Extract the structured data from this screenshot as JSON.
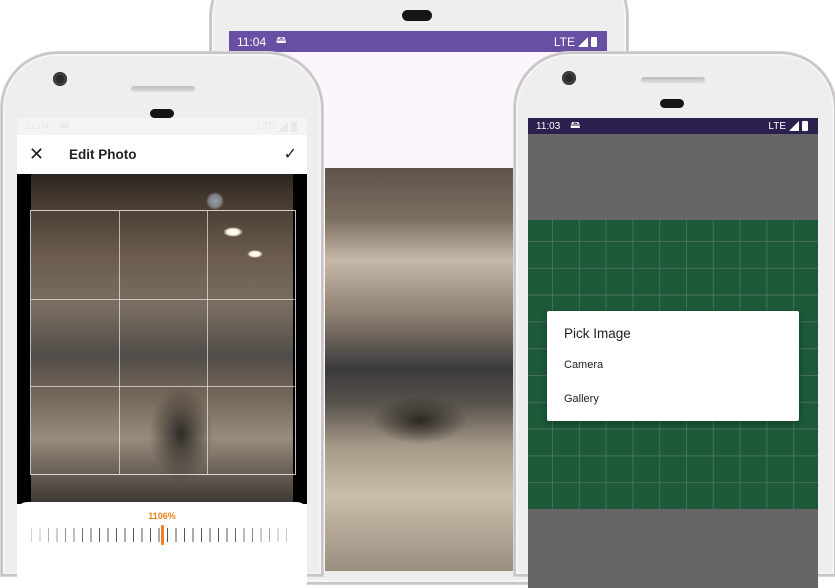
{
  "colors": {
    "accent_orange": "#f07f1d",
    "purple_status": "#6750a4",
    "dark_status": "#2a1f4d",
    "grid_green": "#1c5a3a",
    "scrim_gray": "#666567",
    "pale_pink": "#fcf5fd"
  },
  "left_phone": {
    "status": {
      "time": "11:04",
      "sim_icon": "sim-icon",
      "network": "LTE"
    },
    "toolbar": {
      "close_icon": "close-icon",
      "title": "Edit Photo",
      "confirm_icon": "check-icon"
    },
    "rotation": {
      "value_label": "1106%"
    }
  },
  "middle_phone": {
    "status": {
      "time": "11:04",
      "sim_icon": "sim-icon",
      "network": "LTE"
    }
  },
  "right_phone": {
    "status": {
      "time": "11:03",
      "sim_icon": "sim-icon",
      "network": "LTE"
    },
    "dialog": {
      "title": "Pick Image",
      "options": [
        {
          "label": "Camera"
        },
        {
          "label": "Gallery"
        }
      ]
    }
  }
}
